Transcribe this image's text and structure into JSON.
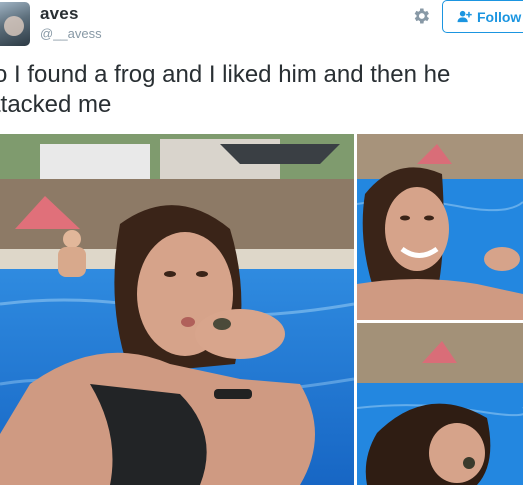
{
  "user": {
    "display_name": "aves",
    "handle": "@__avess",
    "avatar_icon": "profile-avatar"
  },
  "actions": {
    "settings_icon": "gear-icon",
    "follow_icon": "add-user-icon",
    "follow_label": "Follow"
  },
  "tweet": {
    "text": "o I found a frog and I liked him and then he\nttacked me"
  },
  "media": {
    "photos": [
      {
        "name": "main-photo",
        "scene": "pool-selfie-frog"
      },
      {
        "name": "top-right-photo",
        "scene": "pool-smiling"
      },
      {
        "name": "bottom-right-photo",
        "scene": "pool-attacked"
      }
    ]
  },
  "colors": {
    "accent": "#1b95e0",
    "text": "#292f33",
    "muted": "#8899a6",
    "pool": "#1e7fd6"
  }
}
